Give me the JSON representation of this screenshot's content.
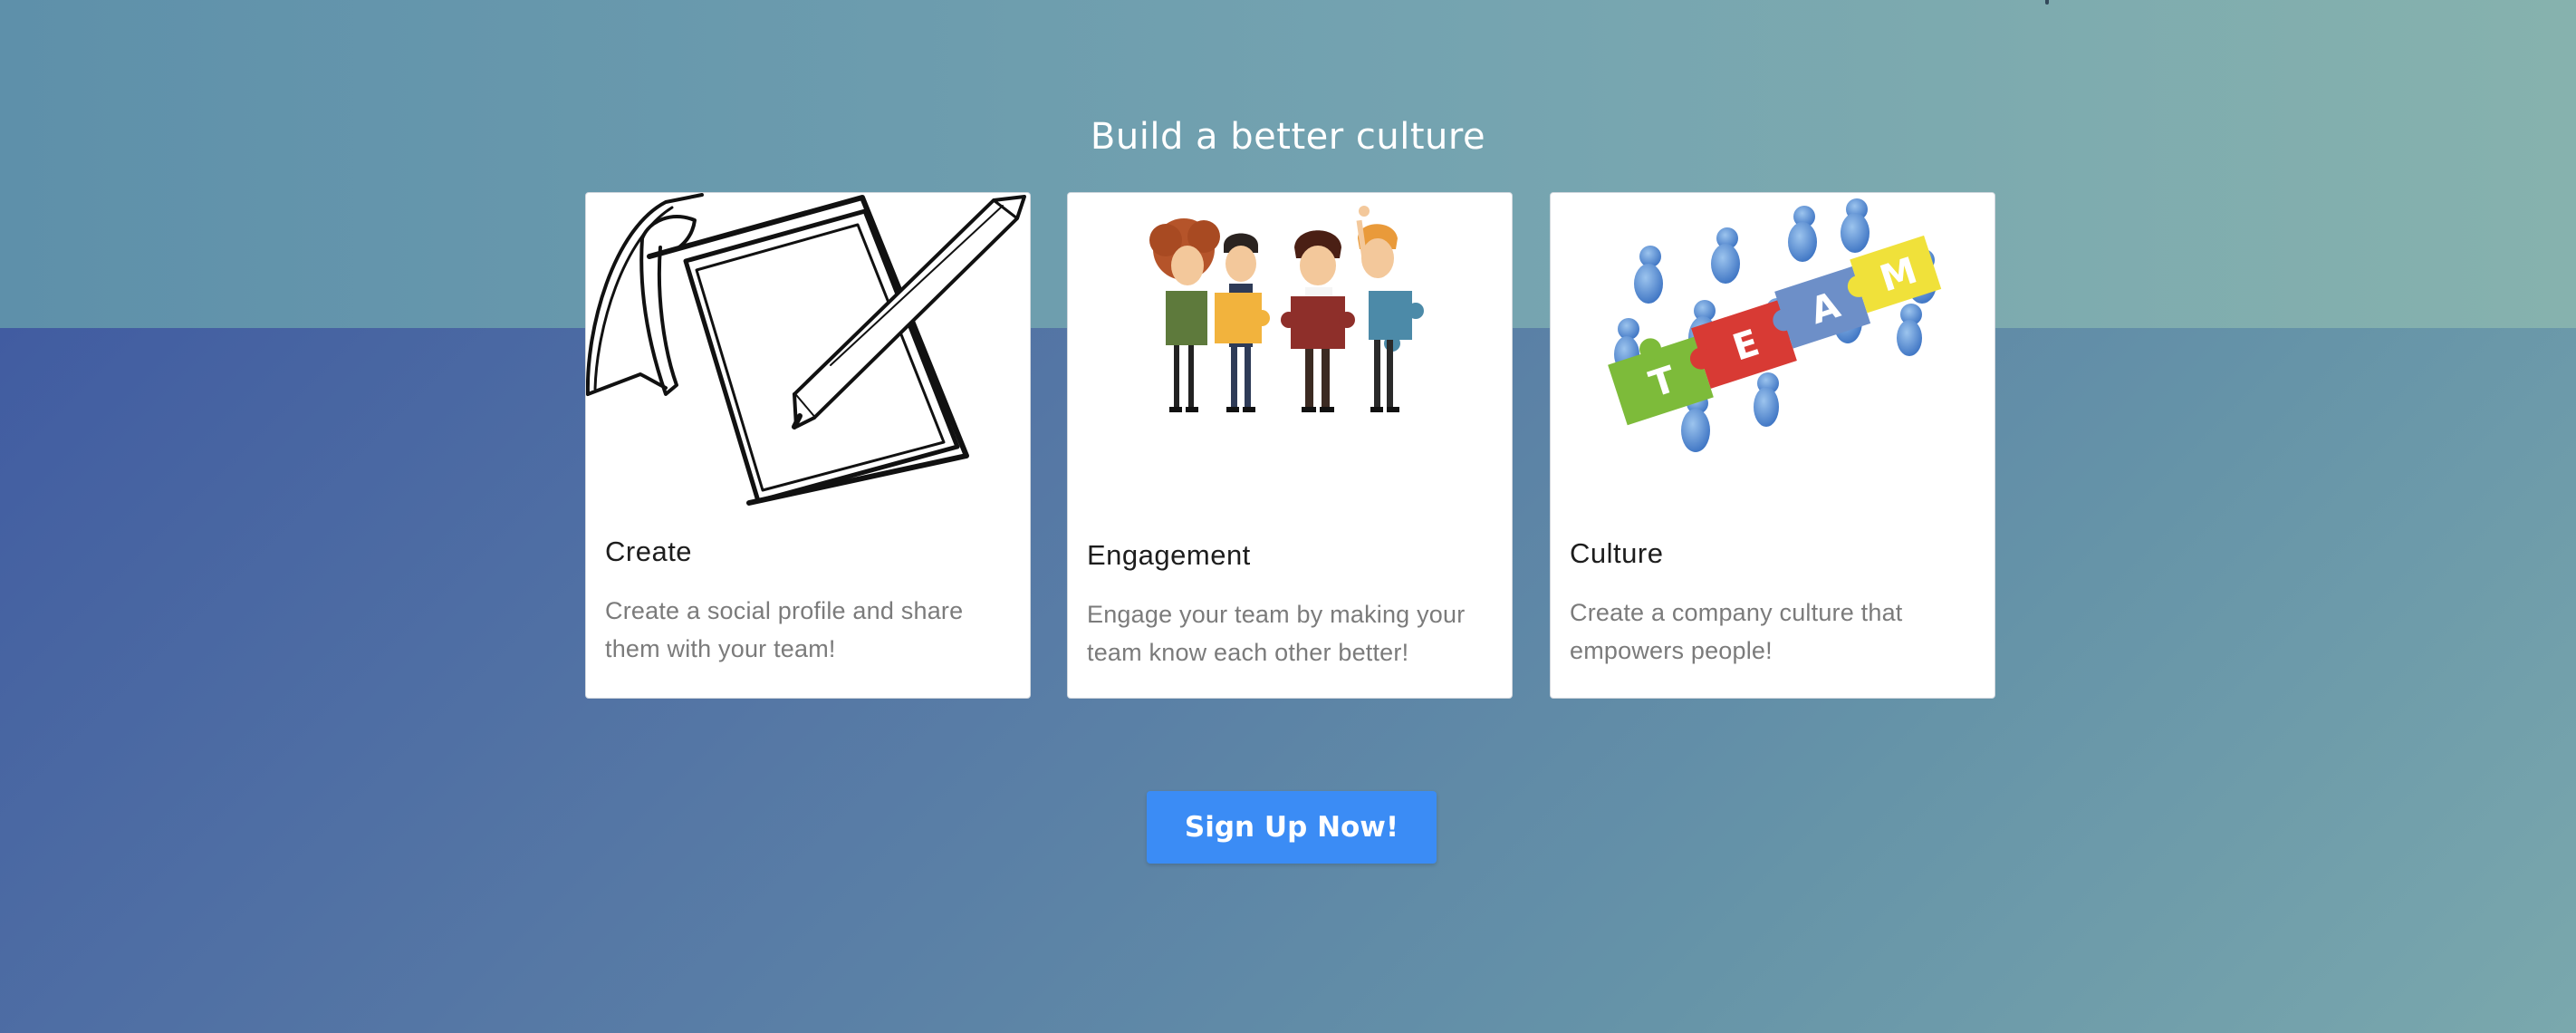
{
  "section": {
    "title": "Build a better culture"
  },
  "cards": [
    {
      "title": "Create",
      "text": "Create a social profile and share them with your team!",
      "icon": "notebook-pencil-illustration"
    },
    {
      "title": "Engagement",
      "text": "Engage your team by making your team know each other better!",
      "icon": "team-puzzle-people-illustration"
    },
    {
      "title": "Culture",
      "text": "Create a company culture that empowers people!",
      "icon": "team-puzzle-figures-illustration"
    }
  ],
  "cta": {
    "label": "Sign Up Now!"
  },
  "team_puzzle_letters": [
    "T",
    "E",
    "A",
    "M"
  ],
  "colors": {
    "top_band": "#74a3b0",
    "bottom_band": "#415ca1",
    "button": "#3b8cf5"
  }
}
